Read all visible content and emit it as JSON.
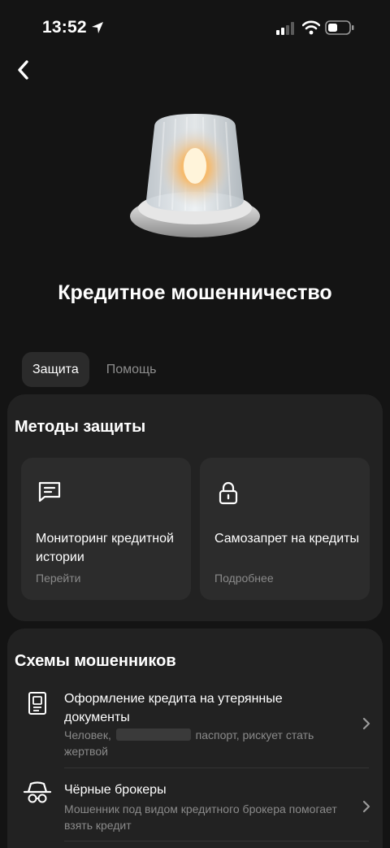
{
  "status_bar": {
    "time": "13:52"
  },
  "header": {
    "title": "Кредитное мошенничество"
  },
  "tabs": [
    {
      "label": "Защита",
      "active": true
    },
    {
      "label": "Помощь",
      "active": false
    }
  ],
  "methods": {
    "title": "Методы защиты",
    "items": [
      {
        "label": "Мониторинг кредитной истории",
        "sub": "Перейти",
        "icon": "message-icon"
      },
      {
        "label": "Самозапрет на кредиты",
        "sub": "Подробнее",
        "icon": "lock-icon"
      }
    ]
  },
  "schemes": {
    "title": "Схемы мошенников",
    "items": [
      {
        "title": "Оформление кредита на утерянные документы",
        "desc_before": "Человек,",
        "desc_after": "паспорт, рискует стать жертвой",
        "icon": "id-card-icon"
      },
      {
        "title": "Чёрные брокеры",
        "desc": "Мошенник под видом кредитного брокера помогает взять кредит",
        "icon": "spy-icon"
      }
    ]
  },
  "colors": {
    "background": "#141414",
    "card": "#222222",
    "tile": "#2c2c2c",
    "muted_text": "#8a8a8a"
  }
}
